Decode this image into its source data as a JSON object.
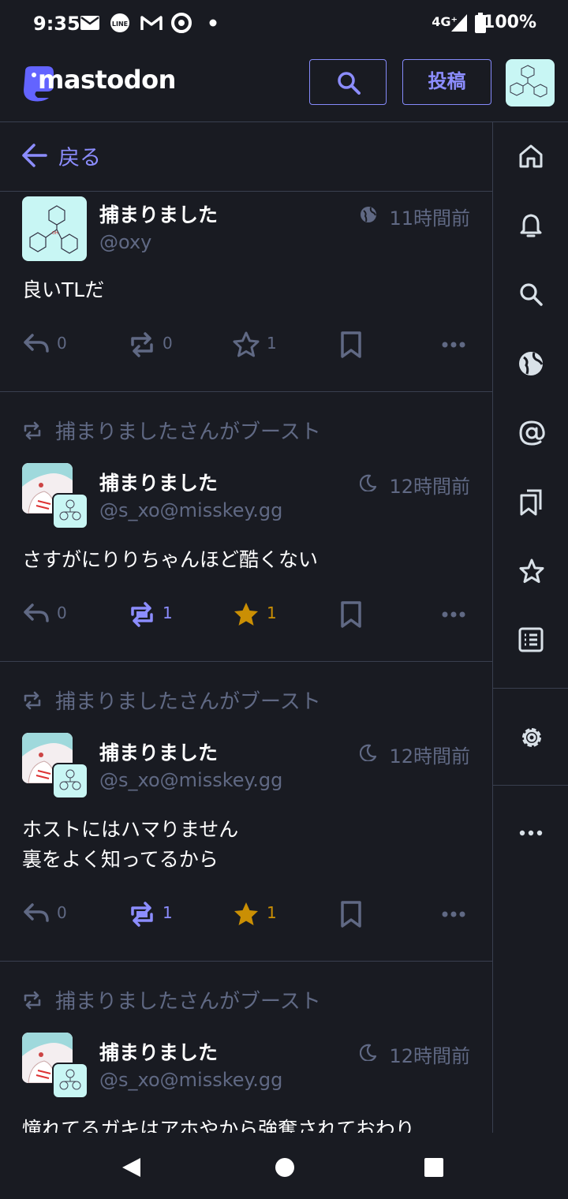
{
  "status_bar": {
    "time": "9:35",
    "network": "4G⁺",
    "battery": "100%"
  },
  "header": {
    "logo_text": "mastodon",
    "post_label": "投稿"
  },
  "back_label": "戻る",
  "colors": {
    "accent": "#8c8dff",
    "background": "#191b22",
    "muted": "#606984",
    "favourite": "#ca8f04",
    "divider": "#393f4f"
  },
  "sidebar_icons": [
    "home-icon",
    "bell-icon",
    "search-icon",
    "globe-icon",
    "at-icon",
    "bookmarks-icon",
    "star-icon",
    "list-icon",
    "gear-icon",
    "more-icon"
  ],
  "posts": [
    {
      "boost_text": "",
      "name": "捕まりました",
      "handle": "@oxy",
      "visibility_icon": "globe-icon",
      "time": "11時間前",
      "content": [
        "良いTLだ"
      ],
      "replies": "0",
      "boosts": "0",
      "favourites": "1",
      "boosted": false,
      "favourited": false
    },
    {
      "boost_text": "捕まりましたさんがブースト",
      "name": "捕まりました",
      "handle": "@s_xo@misskey.gg",
      "visibility_icon": "moon-icon",
      "time": "12時間前",
      "content": [
        "さすがにりりちゃんほど酷くない"
      ],
      "replies": "0",
      "boosts": "1",
      "favourites": "1",
      "boosted": true,
      "favourited": true
    },
    {
      "boost_text": "捕まりましたさんがブースト",
      "name": "捕まりました",
      "handle": "@s_xo@misskey.gg",
      "visibility_icon": "moon-icon",
      "time": "12時間前",
      "content": [
        "ホストにはハマりません",
        "裏をよく知ってるから"
      ],
      "replies": "0",
      "boosts": "1",
      "favourites": "1",
      "boosted": true,
      "favourited": true
    },
    {
      "boost_text": "捕まりましたさんがブースト",
      "name": "捕まりました",
      "handle": "@s_xo@misskey.gg",
      "visibility_icon": "moon-icon",
      "time": "12時間前",
      "content": [
        "憧れてるガキはアホやから強奪されておわり"
      ],
      "replies": "",
      "boosts": "",
      "favourites": "",
      "boosted": false,
      "favourited": false
    }
  ]
}
